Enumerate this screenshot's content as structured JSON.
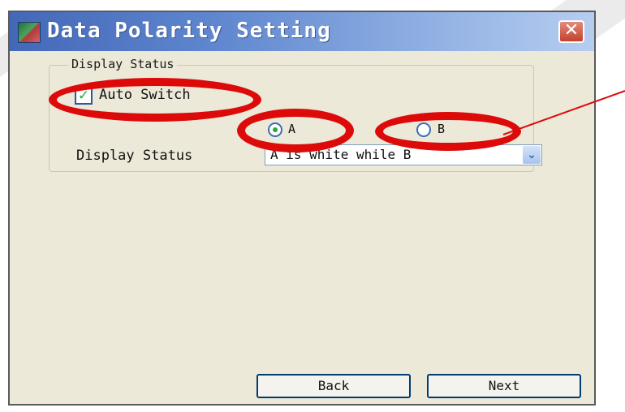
{
  "window": {
    "title": "Data Polarity Setting",
    "close_glyph": "✕"
  },
  "group": {
    "legend": "Display Status"
  },
  "auto_switch": {
    "label": "Auto Switch",
    "checked": true,
    "check_glyph": "✓"
  },
  "radios": [
    {
      "label": "A",
      "selected": true
    },
    {
      "label": "B",
      "selected": false
    }
  ],
  "display_status": {
    "label": "Display Status",
    "selected_value": "A is white while B",
    "dropdown_glyph": "⌄"
  },
  "buttons": {
    "back": "Back",
    "next": "Next"
  },
  "annotation": {
    "color": "#dd0a0a"
  },
  "colors": {
    "window_bg": "#ece9d8",
    "titlebar_start": "#4368b8",
    "titlebar_end": "#b6cdf0",
    "close_btn": "#c2412e"
  }
}
